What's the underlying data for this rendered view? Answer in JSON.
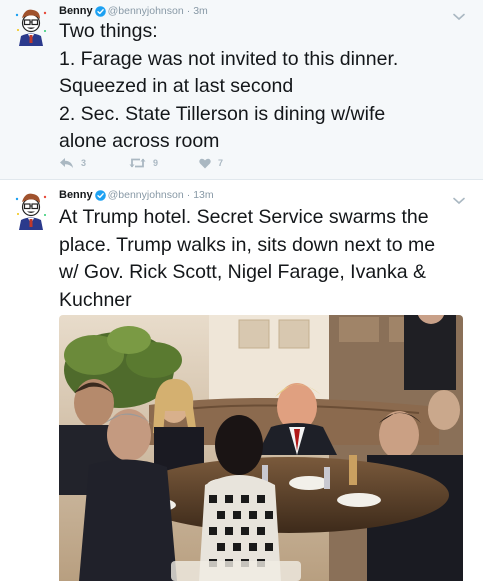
{
  "tweets": [
    {
      "author_name": "Benny",
      "handle": "@bennyjohnson",
      "separator": "·",
      "time": "3m",
      "lines": [
        "Two things:",
        "1. Farage was not invited to this dinner.",
        "Squeezed in at last second",
        "2. Sec. State Tillerson is dining  w/wife",
        "alone across room"
      ],
      "actions": {
        "replies": "3",
        "retweets": "9",
        "likes": "7"
      }
    },
    {
      "author_name": "Benny",
      "handle": "@bennyjohnson",
      "separator": "·",
      "time": "13m",
      "lines": [
        "At Trump hotel. Secret Service swarms the",
        "place. Trump walks in, sits down next to me",
        "w/ Gov. Rick Scott, Nigel Farage, Ivanka &",
        "Kuchner"
      ]
    }
  ],
  "icons": {
    "verified": "verified-badge-icon",
    "reply": "reply-icon",
    "retweet": "retweet-icon",
    "like": "heart-icon",
    "more": "chevron-down-icon"
  },
  "colors": {
    "highlight_bg": "#f5f8fa",
    "text": "#14171a",
    "secondary": "#8899a6",
    "action_grey": "#aab8c2",
    "verified_blue": "#1da1f2"
  }
}
